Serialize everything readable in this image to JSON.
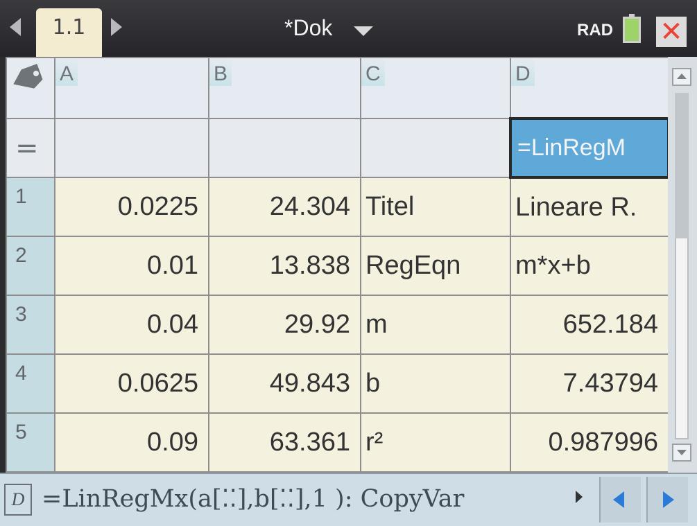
{
  "titlebar": {
    "tab_label": "1.1",
    "document_title": "*Dok",
    "angle_mode": "RAD",
    "close_symbol": "✕"
  },
  "columns": [
    {
      "letter": "A"
    },
    {
      "letter": "B"
    },
    {
      "letter": "C"
    },
    {
      "letter": "D"
    }
  ],
  "formula_row": {
    "label": "=",
    "A": "",
    "B": "",
    "C": "",
    "D": "=LinRegM"
  },
  "rows": [
    {
      "num": "1",
      "A": "0.0225",
      "B": "24.304",
      "C": "Titel",
      "D": "Lineare R."
    },
    {
      "num": "2",
      "A": "0.01",
      "B": "13.838",
      "C": "RegEqn",
      "D": "m*x+b"
    },
    {
      "num": "3",
      "A": "0.04",
      "B": "29.92",
      "C": "m",
      "D": "652.184"
    },
    {
      "num": "4",
      "A": "0.0625",
      "B": "49.843",
      "C": "b",
      "D": "7.43794"
    },
    {
      "num": "5",
      "A": "0.09",
      "B": "63.361",
      "C": "r²",
      "D": "0.987996"
    }
  ],
  "entry_line": {
    "cell_ref": "D",
    "formula": "=LinRegMx(a[⁚⁚],b[⁚⁚],1 ): CopyVar"
  },
  "colors": {
    "cell_background": "#f5f1df",
    "row_header": "#c5dde2",
    "selected_cell": "#5ea9d8",
    "nav_arrow": "#2a7bd6",
    "close_button": "#e8443a"
  },
  "scroll": {
    "position_fraction": 0.0
  }
}
